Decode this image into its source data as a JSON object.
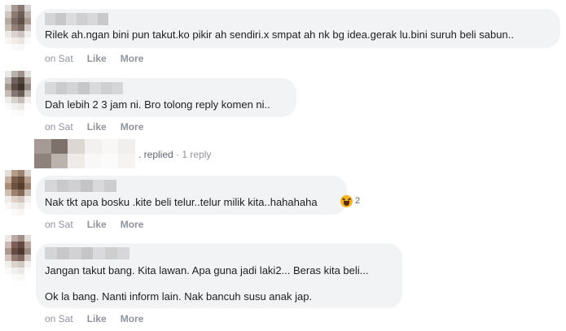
{
  "comments": [
    {
      "text": "Rilek ah.ngan bini pun takut.ko pikir ah sendiri.x smpat ah nk bg idea.gerak lu.bini suruh beli sabun..",
      "time": "on Sat",
      "like": "Like",
      "more": "More"
    },
    {
      "text": "Dah lebih 2 3 jam ni. Bro tolong reply komen ni..",
      "time": "on Sat",
      "like": "Like",
      "more": "More"
    },
    {
      "text": "Nak tkt apa bosku .kite beli telur..telur milik kita..hahahaha",
      "time": "on Sat",
      "like": "Like",
      "more": "More",
      "reaction_count": "2"
    },
    {
      "text_lines": [
        "Jangan takut bang. Kita lawan. Apa guna jadi laki2... Beras kita beli...",
        "Ok la bang. Nanti inform lain. Nak bancuh susu anak jap."
      ],
      "time": "on Sat",
      "like": "Like",
      "more": "More"
    }
  ],
  "reply_summary": {
    "replied": ". replied",
    "separator": "·",
    "count": "1 reply"
  },
  "colors": {
    "bubble": "#f2f3f5",
    "meta_text": "#90949c",
    "reaction": "#f7b125"
  },
  "icons": {
    "reaction": "laughing-emoji-icon"
  }
}
